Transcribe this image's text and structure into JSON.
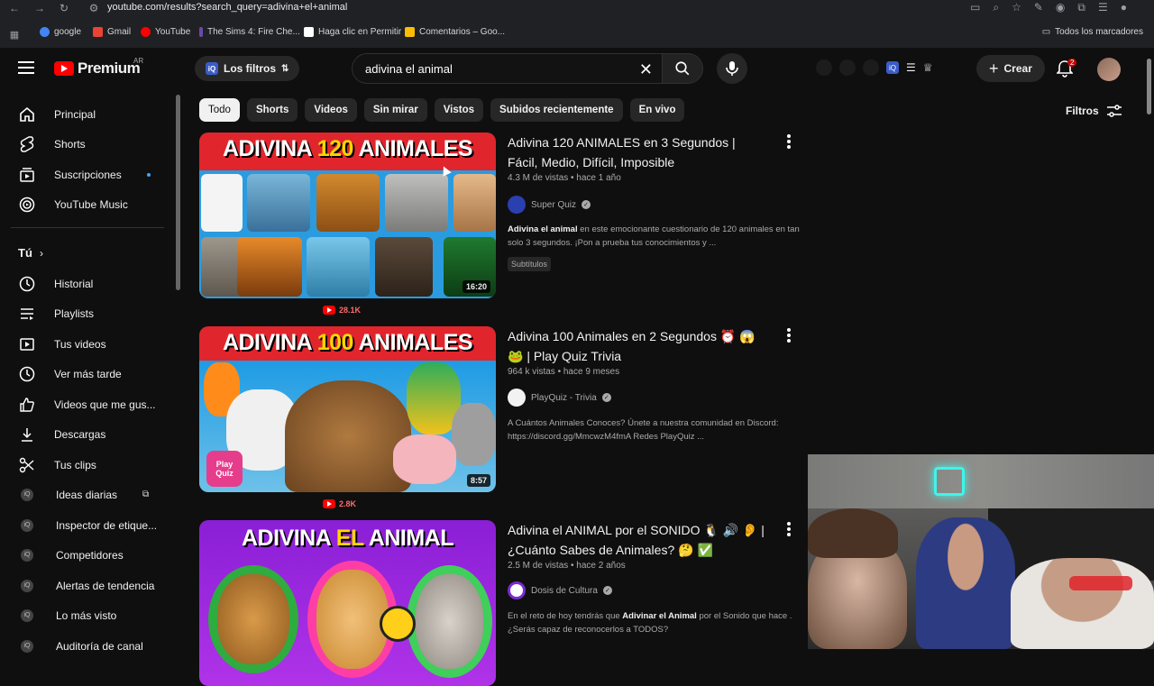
{
  "browser": {
    "url": "youtube.com/results?search_query=adivina+el+animal",
    "bookmarks": [
      {
        "label": "google",
        "color": "#4285f4"
      },
      {
        "label": "Gmail",
        "color": "#ea4335"
      },
      {
        "label": "YouTube",
        "color": "#ff0000"
      },
      {
        "label": "The Sims 4: Fire Che...",
        "color": "#6a4aa8"
      },
      {
        "label": "Haga clic en Permitir",
        "color": "#ffffff"
      },
      {
        "label": "Comentarios – Goo...",
        "color": "#fbbc04"
      }
    ],
    "all_bookmarks": "Todos los marcadores"
  },
  "header": {
    "logo": "Premium",
    "region": "AR",
    "filters_pill": "Los filtros",
    "search_value": "adivina el animal",
    "create_label": "Crear",
    "notifications_count": "2"
  },
  "sidebar": {
    "main": [
      {
        "label": "Principal",
        "icon": "home-icon"
      },
      {
        "label": "Shorts",
        "icon": "shorts-icon"
      },
      {
        "label": "Suscripciones",
        "icon": "subscriptions-icon"
      },
      {
        "label": "YouTube Music",
        "icon": "music-icon"
      }
    ],
    "you_heading": "Tú",
    "you": [
      {
        "label": "Historial",
        "icon": "history-icon"
      },
      {
        "label": "Playlists",
        "icon": "playlists-icon"
      },
      {
        "label": "Tus videos",
        "icon": "your-videos-icon"
      },
      {
        "label": "Ver más tarde",
        "icon": "watch-later-icon"
      },
      {
        "label": "Videos que me gus...",
        "icon": "like-icon"
      },
      {
        "label": "Descargas",
        "icon": "download-icon"
      },
      {
        "label": "Tus clips",
        "icon": "clips-icon"
      }
    ],
    "extension": [
      {
        "label": "Ideas diarias"
      },
      {
        "label": "Inspector de etique..."
      },
      {
        "label": "Competidores"
      },
      {
        "label": "Alertas de tendencia"
      },
      {
        "label": "Lo más visto"
      },
      {
        "label": "Auditoría de canal"
      }
    ]
  },
  "chips": [
    "Todo",
    "Shorts",
    "Videos",
    "Sin mirar",
    "Vistos",
    "Subidos recientemente",
    "En vivo"
  ],
  "filters_label": "Filtros",
  "videos": [
    {
      "thumb_title_a": "ADIVINA ",
      "thumb_title_b": "120",
      "thumb_title_c": " ANIMALES",
      "duration": "16:20",
      "below_views": "28.1K",
      "title": "Adivina 120 ANIMALES en 3 Segundos | Fácil, Medio, Difícil, Imposible",
      "meta": "4.3 M de vistas • hace 1 año",
      "channel": "Super Quiz",
      "desc_bold": "Adivina el animal",
      "desc_rest": " en este emocionante cuestionario de 120 animales en tan solo 3 segundos. ¡Pon a prueba tus conocimientos y ...",
      "badge": "Subtítulos"
    },
    {
      "thumb_title_a": "ADIVINA ",
      "thumb_title_b": "100",
      "thumb_title_c": " ANIMALES",
      "duration": "8:57",
      "below_views": "2.8K",
      "title": "Adivina 100 Animales en 2 Segundos ⏰ 😱 🐸 | Play Quiz Trivia",
      "meta": "964 k vistas • hace 9 meses",
      "channel": "PlayQuiz - Trivia",
      "desc_bold": "",
      "desc_rest": "A Cuántos Animales Conoces? Únete a nuestra comunidad en Discord: https://discord.gg/MmcwzM4fmA Redes PlayQuiz ...",
      "thumb_badge": "Play Quiz"
    },
    {
      "thumb_title_a": "ADIVINA ",
      "thumb_title_b": "EL",
      "thumb_title_c": " ANIMAL",
      "title": "Adivina el ANIMAL por el SONIDO 🐧 🔊 👂 | ¿Cuánto Sabes de Animales? 🤔 ✅",
      "meta": "2.5 M de vistas • hace 2 años",
      "channel": "Dosis de Cultura",
      "desc_pre": "En el reto de hoy tendrás que ",
      "desc_bold": "Adivinar el Animal",
      "desc_rest": " por el Sonido que hace . ¿Serás capaz de reconocerlos a TODOS?"
    }
  ]
}
